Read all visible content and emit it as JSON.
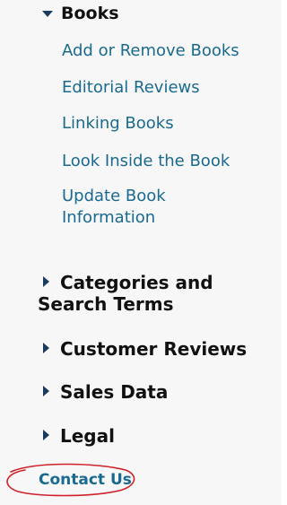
{
  "books_section": {
    "label": "Books",
    "links": [
      "Add or Remove Books",
      "Editorial Reviews",
      "Linking Books",
      "Look Inside the Book",
      "Update Book Information"
    ]
  },
  "sections": [
    "Categories and Search Terms",
    "Customer Reviews",
    "Sales Data",
    "Legal"
  ],
  "contact": {
    "label": "Contact Us"
  },
  "colors": {
    "link": "#1a6a8f",
    "heading": "#111111",
    "annotation": "#d0202a"
  }
}
